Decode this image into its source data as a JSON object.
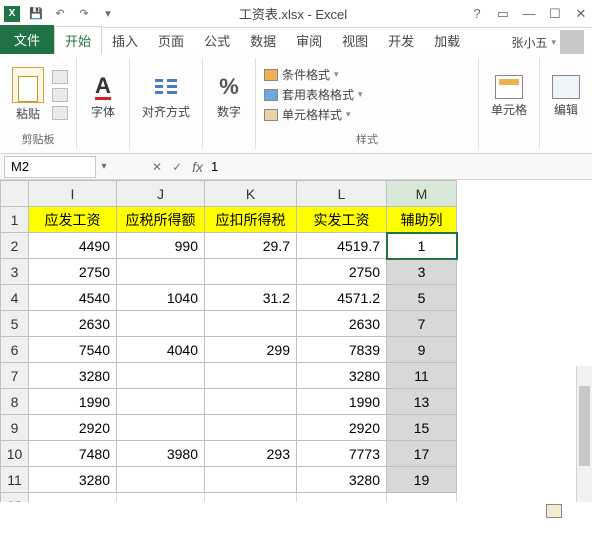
{
  "app": {
    "title": "工资表.xlsx - Excel"
  },
  "tabs": {
    "file": "文件",
    "home": "开始",
    "insert": "插入",
    "page": "页面",
    "formulas": "公式",
    "data": "数据",
    "review": "审阅",
    "view": "视图",
    "dev": "开发",
    "addin": "加载"
  },
  "user": {
    "name": "张小五"
  },
  "ribbon": {
    "paste": "粘贴",
    "clip": "剪贴板",
    "font": "字体",
    "align": "对齐方式",
    "number": "数字",
    "cond": "条件格式",
    "tbl": "套用表格格式",
    "cellst": "单元格样式",
    "styles": "样式",
    "cells": "单元格",
    "edit": "编辑"
  },
  "namebox": "M2",
  "formula": "1",
  "fx": "fx",
  "cols": [
    "I",
    "J",
    "K",
    "L",
    "M"
  ],
  "headers": {
    "I": "应发工资",
    "J": "应税所得额",
    "K": "应扣所得税",
    "L": "实发工资",
    "M": "辅助列"
  },
  "chart_data": {
    "type": "table",
    "columns": [
      "应发工资",
      "应税所得额",
      "应扣所得税",
      "实发工资",
      "辅助列"
    ],
    "rows": [
      {
        "I": 4490,
        "J": 990,
        "K": 29.7,
        "L": 4519.7,
        "M": 1
      },
      {
        "I": 2750,
        "J": "",
        "K": "",
        "L": 2750,
        "M": 3
      },
      {
        "I": 4540,
        "J": 1040,
        "K": 31.2,
        "L": 4571.2,
        "M": 5
      },
      {
        "I": 2630,
        "J": "",
        "K": "",
        "L": 2630,
        "M": 7
      },
      {
        "I": 7540,
        "J": 4040,
        "K": 299,
        "L": 7839,
        "M": 9
      },
      {
        "I": 3280,
        "J": "",
        "K": "",
        "L": 3280,
        "M": 11
      },
      {
        "I": 1990,
        "J": "",
        "K": "",
        "L": 1990,
        "M": 13
      },
      {
        "I": 2920,
        "J": "",
        "K": "",
        "L": 2920,
        "M": 15
      },
      {
        "I": 7480,
        "J": 3980,
        "K": 293,
        "L": 7773,
        "M": 17
      },
      {
        "I": 3280,
        "J": "",
        "K": "",
        "L": 3280,
        "M": 19
      }
    ]
  }
}
